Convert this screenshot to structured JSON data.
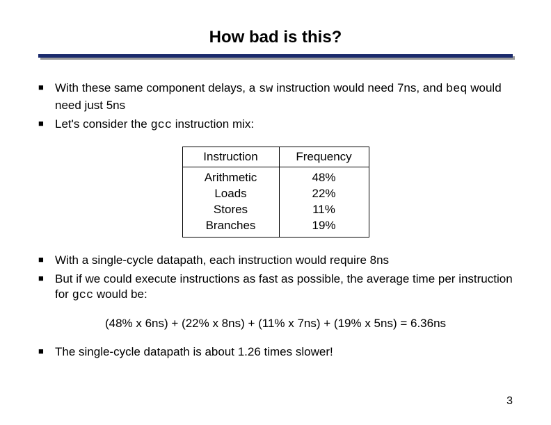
{
  "title": "How bad is this?",
  "bullets_top": [
    {
      "pre": "With these same component delays, a ",
      "mono1": "sw",
      "mid": " instruction would need 7ns, and ",
      "mono2": "beq",
      "post": " would need just 5ns"
    },
    {
      "pre": "Let's consider the ",
      "mono1": "gcc",
      "mid": " instruction mix:",
      "mono2": "",
      "post": ""
    }
  ],
  "chart_data": {
    "type": "table",
    "headers": [
      "Instruction",
      "Frequency"
    ],
    "rows": [
      {
        "instruction": "Arithmetic",
        "frequency": "48%"
      },
      {
        "instruction": "Loads",
        "frequency": "22%"
      },
      {
        "instruction": "Stores",
        "frequency": "11%"
      },
      {
        "instruction": "Branches",
        "frequency": "19%"
      }
    ]
  },
  "bullets_mid": [
    {
      "text": "With a single-cycle datapath, each instruction would require 8ns"
    },
    {
      "pre": "But if we could execute instructions as fast as possible, the average time per instruction for ",
      "mono": "gcc",
      "post": " would be:"
    }
  ],
  "calc": "(48% x 6ns) + (22% x 8ns) + (11% x 7ns) + (19% x 5ns) = 6.36ns",
  "bullets_bot": [
    {
      "text": "The single-cycle datapath is about 1.26 times slower!"
    }
  ],
  "page_number": "3"
}
